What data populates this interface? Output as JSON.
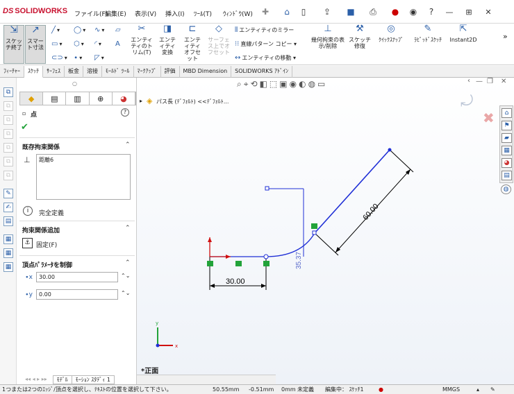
{
  "app": {
    "logo_prefix": "DS",
    "logo_text": "SOLIDWORKS"
  },
  "menu": [
    "ファイル(F)",
    "編集(E)",
    "表示(V)",
    "挿入(I)",
    "ﾂｰﾙ(T)",
    "ｳｨﾝﾄﾞｳ(W)"
  ],
  "ribbon": {
    "sketch_exit": "スケッチ終了",
    "smart_dim": "スマート寸法",
    "trim": "エンティティのトリム(T)",
    "convert": "エンティティ変換",
    "offset": "エンティティオフセット",
    "surface_offset": "サーフェス上でオフセット",
    "mirror": "エンティティのミラー",
    "linear_pattern": "直線パターン コピー",
    "move": "エンティティの移動",
    "display_delete": "幾何拘束の表示/削除",
    "repair": "スケッチ修復",
    "quick_snap": "ｸｲｯｸｽﾅｯﾌﾟ",
    "rapid_sketch": "ﾗﾋﾟｯﾄﾞｽｹｯﾁ",
    "instant2d": "Instant2D"
  },
  "tabs": [
    "ﾌｨｰﾁｬｰ",
    "ｽｹｯﾁ",
    "ｻｰﾌｪｽ",
    "板金",
    "溶接",
    "ﾓｰﾙﾄﾞ ﾂｰﾙ",
    "ﾏｰｸｱｯﾌﾟ",
    "評価",
    "MBD Dimension",
    "SOLIDWORKS ｱﾄﾞｲﾝ"
  ],
  "pm": {
    "title": "点",
    "existing_relations": "既存拘束関係",
    "relation_item": "距離6",
    "fully_defined": "完全定義",
    "add_relations": "拘束関係追加",
    "fix": "固定(F)",
    "params": "頂点ﾊﾟﾗﾒｰﾀを制御",
    "x_value": "30.00",
    "y_value": "0.00"
  },
  "graphics": {
    "tree_label": "パス長 (ﾃﾞﾌｫﾙﾄ) <<ﾃﾞﾌｫﾙﾄ...",
    "dim_30": "30.00",
    "dim_60": "60.00",
    "dim_3537": "35.37",
    "view_label": "*正面"
  },
  "bottom_tabs": [
    "ﾓﾃﾞﾙ",
    "ﾓｰｼｮﾝ ｽﾀﾃﾞｨ 1"
  ],
  "status": {
    "hint": "1つまたは2つのｴｯｼﾞ/頂点を選択し、ﾃｷｽﾄの位置を選択して下さい。",
    "x": "50.55mm",
    "y": "-0.51mm",
    "z": "0mm",
    "state": "未定義",
    "editing": "編集中： ｽｹｯﾁ1",
    "units": "MMGS"
  },
  "colors": {
    "accent": "#2b5fa8",
    "sketch_blue": "#1f2fd6",
    "relation_green": "#22a33a",
    "origin_red": "#d01010"
  }
}
